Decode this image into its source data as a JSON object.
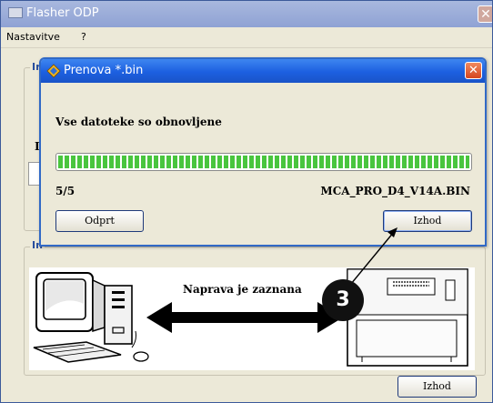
{
  "main_window": {
    "title": "Flasher ODP",
    "close_glyph": "✕",
    "menu": [
      "Nastavitve",
      "?"
    ],
    "background_fragments": {
      "group1_legend": "Ir",
      "label_d": "D",
      "group2_legend": "In"
    },
    "status_text": "Naprava je zaznana",
    "exit_label": "Izhod"
  },
  "dialog": {
    "title": "Prenova *.bin",
    "close_glyph": "✕",
    "message": "Vse datoteke so obnovljene",
    "progress_fraction": 1.0,
    "count": "5/5",
    "filename": "MCA_PRO_D4_V14A.BIN",
    "open_label": "Odprt",
    "exit_label": "Izhod"
  },
  "callout": {
    "number": "3"
  },
  "colors": {
    "dialog_titlebar": "#1c5fe0",
    "progress": "#49c53e",
    "callout": "#111111"
  },
  "icons": [
    "window-icon",
    "dialog-logo-icon",
    "close-icon",
    "computer-icon",
    "device-icon",
    "double-arrow-icon"
  ]
}
